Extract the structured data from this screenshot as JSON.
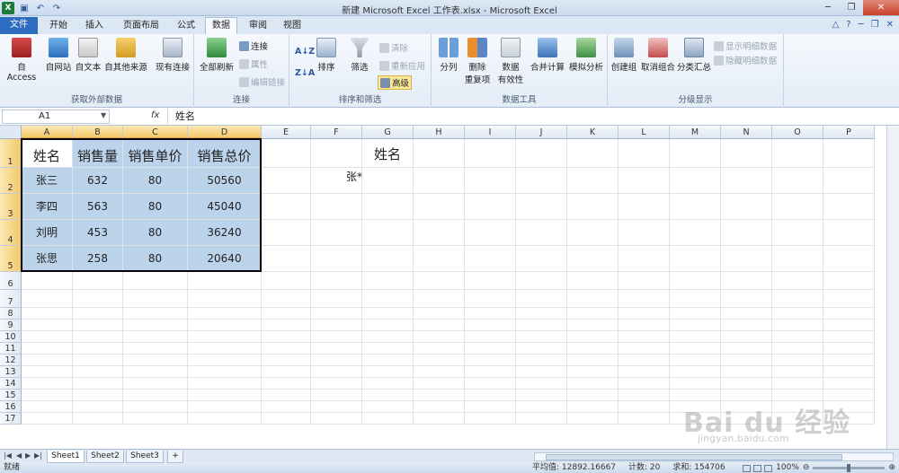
{
  "window": {
    "title": "新建 Microsoft Excel 工作表.xlsx - Microsoft Excel"
  },
  "quick_access": [
    {
      "icon": "excel-logo-icon"
    },
    {
      "icon": "save-icon"
    },
    {
      "icon": "undo-icon"
    },
    {
      "icon": "redo-icon"
    }
  ],
  "tabs": [
    {
      "label": "文件",
      "id": "file"
    },
    {
      "label": "开始",
      "id": "home"
    },
    {
      "label": "插入",
      "id": "insert"
    },
    {
      "label": "页面布局",
      "id": "layout"
    },
    {
      "label": "公式",
      "id": "formulas"
    },
    {
      "label": "数据",
      "id": "data",
      "active": true
    },
    {
      "label": "审阅",
      "id": "review"
    },
    {
      "label": "视图",
      "id": "view"
    }
  ],
  "ribbon": {
    "get_external": {
      "label": "获取外部数据",
      "buttons": [
        "自 Access",
        "自网站",
        "自文本",
        "自其他来源",
        "现有连接"
      ]
    },
    "connections": {
      "label": "连接",
      "refresh_all": "全部刷新",
      "connections": "连接",
      "properties": "属性",
      "edit_links": "编辑链接"
    },
    "sort_filter": {
      "label": "排序和筛选",
      "sort": "排序",
      "filter": "筛选",
      "clear": "清除",
      "reapply": "重新应用",
      "advanced": "高级"
    },
    "data_tools": {
      "label": "数据工具",
      "text_to_columns": "分列",
      "remove_dup_1": "删除",
      "remove_dup_2": "重复项",
      "validation_1": "数据",
      "validation_2": "有效性",
      "consolidate": "合并计算",
      "whatif": "模拟分析"
    },
    "outline": {
      "label": "分级显示",
      "group": "创建组",
      "ungroup": "取消组合",
      "subtotal": "分类汇总",
      "show_detail": "显示明细数据",
      "hide_detail": "隐藏明细数据"
    }
  },
  "formula_bar": {
    "name_box": "A1",
    "fx": "fx",
    "formula": "姓名"
  },
  "columns": [
    "A",
    "B",
    "C",
    "D",
    "E",
    "F",
    "G",
    "H",
    "I",
    "J",
    "K",
    "L",
    "M",
    "N",
    "O",
    "P"
  ],
  "rows": [
    "1",
    "2",
    "3",
    "4",
    "5",
    "6",
    "7",
    "8",
    "9",
    "10",
    "11",
    "12",
    "13",
    "14",
    "15",
    "16",
    "17"
  ],
  "table": {
    "headers": [
      "姓名",
      "销售量",
      "销售单价",
      "销售总价"
    ],
    "rows": [
      [
        "张三",
        "632",
        "80",
        "50560"
      ],
      [
        "李四",
        "563",
        "80",
        "45040"
      ],
      [
        "刘明",
        "453",
        "80",
        "36240"
      ],
      [
        "张思",
        "258",
        "80",
        "20640"
      ]
    ]
  },
  "criteria": {
    "header": "姓名",
    "value": "张*"
  },
  "sheets": [
    "Sheet1",
    "Sheet2",
    "Sheet3"
  ],
  "status": {
    "ready": "就绪",
    "average": "平均值: 12892.16667",
    "count": "计数: 20",
    "sum": "求和: 154706",
    "zoom": "100%"
  },
  "watermark": {
    "text": "Bai du 经验",
    "url": "jingyan.baidu.com"
  }
}
